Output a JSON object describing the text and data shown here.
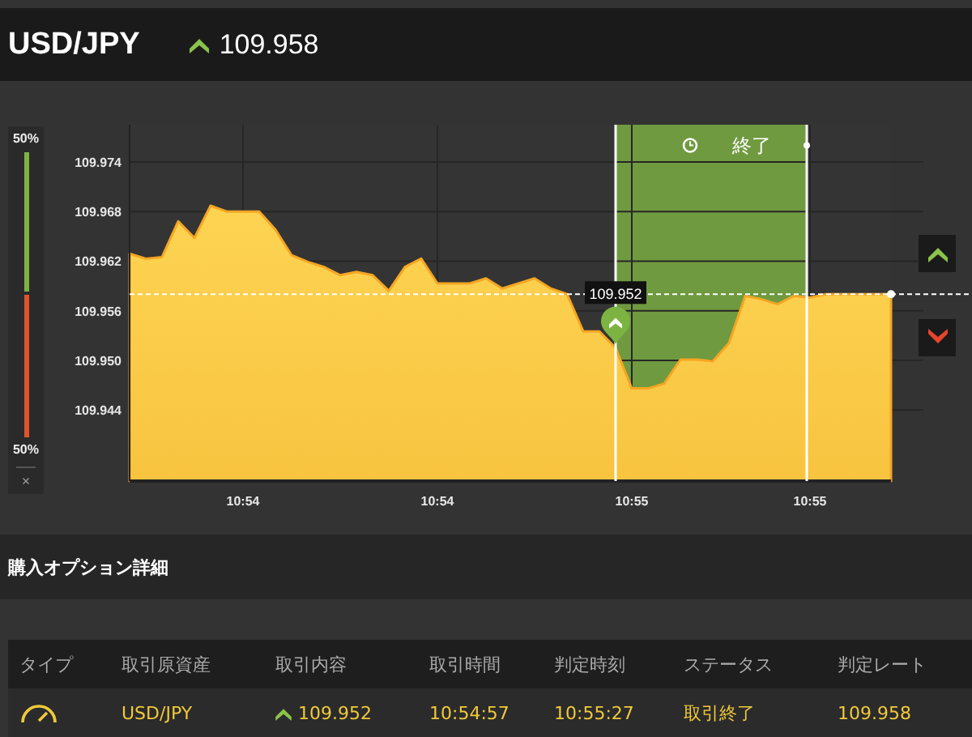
{
  "header": {
    "pair": "USD/JPY",
    "up": true,
    "rate": "109.958"
  },
  "meter": {
    "top_label": "50%",
    "level": 0.5,
    "bottom_label": "50%",
    "close": "×"
  },
  "chart": {
    "chart_data": {
      "type": "area",
      "categories": [
        null,
        null,
        null,
        null,
        null,
        null,
        null,
        "10:54",
        null,
        null,
        null,
        null,
        null,
        null,
        null,
        null,
        null,
        null,
        null,
        "10:54",
        null,
        null,
        null,
        null,
        null,
        null,
        null,
        null,
        null,
        null,
        null,
        "10:55",
        null,
        null,
        null,
        null,
        null,
        null,
        null,
        null,
        null,
        null,
        "10:55",
        null,
        null,
        null,
        null,
        null
      ],
      "series": [
        {
          "color": "#f5a623",
          "values": [
            109.9629,
            109.9623,
            109.9625,
            109.9668,
            109.9648,
            109.9687,
            109.968,
            109.968,
            109.968,
            109.9658,
            109.9627,
            109.9619,
            109.9613,
            109.9603,
            109.9607,
            109.9603,
            109.9584,
            109.9613,
            109.9623,
            109.9593,
            109.9593,
            109.9593,
            109.9599,
            109.9587,
            109.9593,
            109.9599,
            109.9587,
            109.958,
            109.9535,
            109.9535,
            109.9515,
            109.9466,
            109.9466,
            109.9472,
            109.9501,
            109.9501,
            109.9499,
            109.9521,
            109.9578,
            109.9574,
            109.9568,
            109.9578,
            109.9576,
            109.958,
            109.958,
            109.958,
            109.958,
            109.958
          ]
        }
      ],
      "ylim": [
        109.9354,
        109.9785
      ],
      "yticks": [
        {
          "value": 109.974,
          "label": "109.974"
        },
        {
          "value": 109.968,
          "label": "109.968"
        },
        {
          "value": 109.962,
          "label": "109.962"
        },
        {
          "value": 109.956,
          "label": "109.956"
        },
        {
          "value": 109.95,
          "label": "109.950"
        },
        {
          "value": 109.944,
          "label": "109.944"
        }
      ],
      "grid": true
    },
    "entry_price": "109.952",
    "expiry_label": "終了"
  },
  "details": {
    "title": "購入オプション詳細",
    "columns": [
      "タイプ",
      "取引原資産",
      "取引内容",
      "取引時間",
      "判定時刻",
      "ステータス",
      "判定レート"
    ],
    "rows": [
      {
        "asset": "USD/JPY",
        "up": true,
        "rate": "109.952",
        "trade_time": "10:54:57",
        "judge_time": "10:55:27",
        "status": "取引終了",
        "judge_rate": "109.958"
      }
    ]
  }
}
